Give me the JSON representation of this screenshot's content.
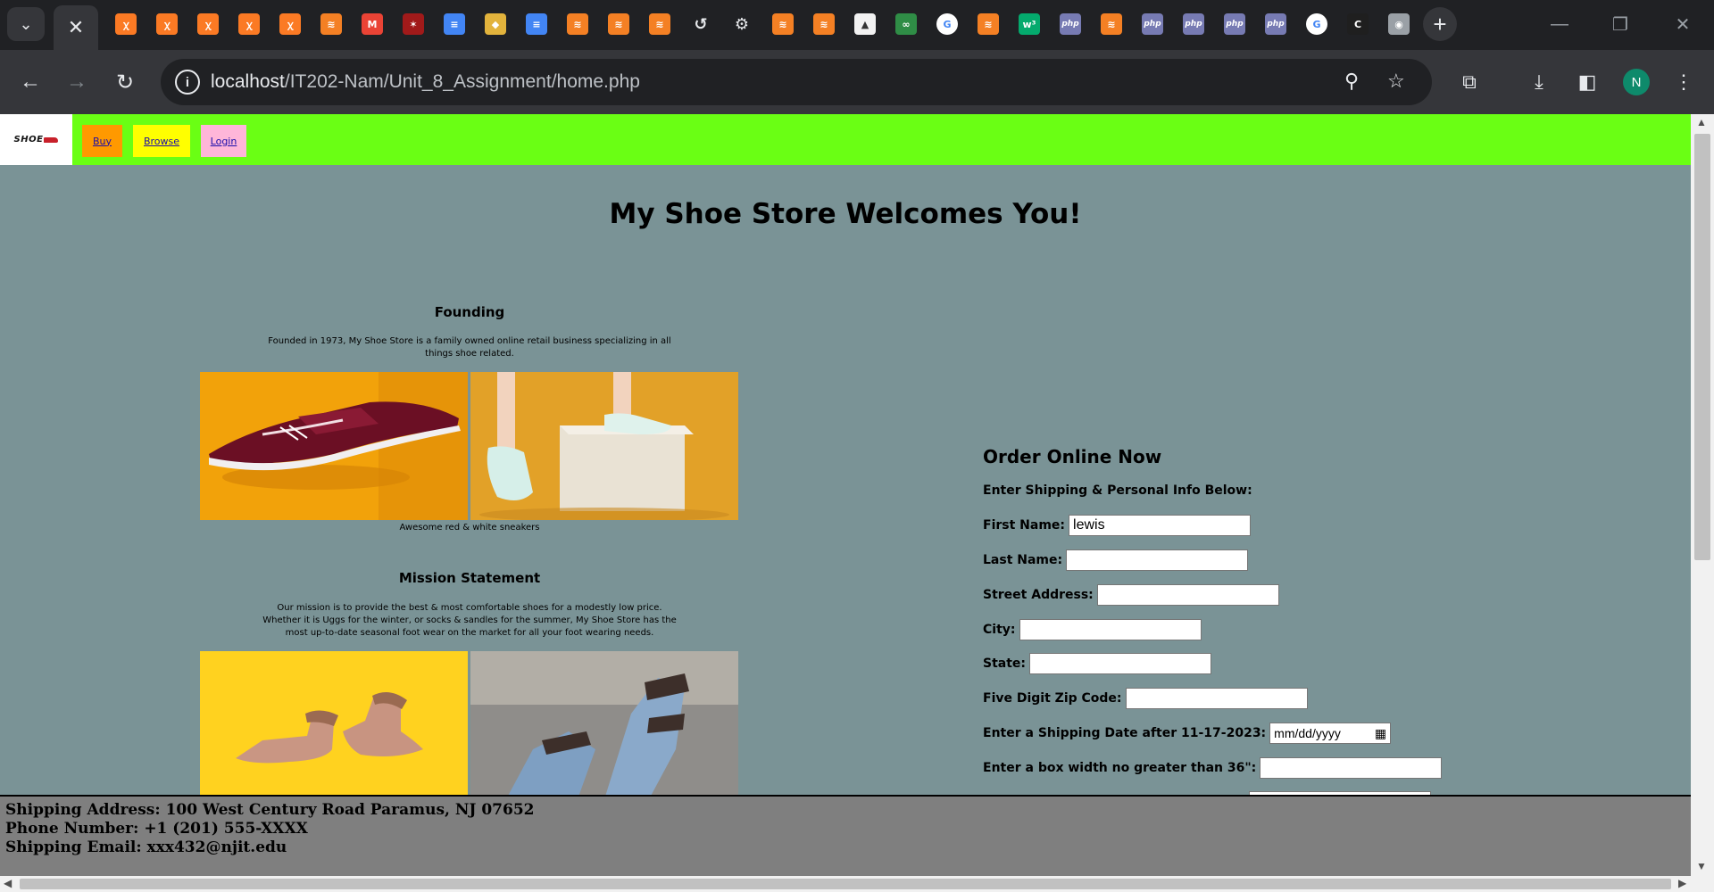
{
  "browser": {
    "active_tab_close": "✕",
    "url_host": "localhost",
    "url_path": "/IT202-Nam/Unit_8_Assignment/home.php",
    "profile_initial": "N",
    "tab_icons": [
      {
        "name": "xampp-icon",
        "glyph": "ꭓ",
        "color": "#fb7a24"
      },
      {
        "name": "xampp-icon",
        "glyph": "ꭓ",
        "color": "#fb7a24"
      },
      {
        "name": "xampp-icon",
        "glyph": "ꭓ",
        "color": "#fb7a24"
      },
      {
        "name": "xampp-icon",
        "glyph": "ꭓ",
        "color": "#fb7a24"
      },
      {
        "name": "xampp-icon",
        "glyph": "ꭓ",
        "color": "#fb7a24"
      },
      {
        "name": "stackoverflow-icon",
        "glyph": "≋",
        "color": "#f48024"
      },
      {
        "name": "gmail-icon",
        "glyph": "M",
        "color": "#ea4335"
      },
      {
        "name": "red-logo-icon",
        "glyph": "✶",
        "color": "#a11a1a"
      },
      {
        "name": "google-docs-icon",
        "glyph": "≡",
        "color": "#4285f4"
      },
      {
        "name": "shield-icon",
        "glyph": "◆",
        "color": "#e2b33c"
      },
      {
        "name": "google-docs-icon",
        "glyph": "≡",
        "color": "#4285f4"
      },
      {
        "name": "stackoverflow-icon",
        "glyph": "≋",
        "color": "#f48024"
      },
      {
        "name": "stackoverflow-icon",
        "glyph": "≋",
        "color": "#f48024"
      },
      {
        "name": "stackoverflow-icon",
        "glyph": "≋",
        "color": "#f48024"
      },
      {
        "name": "history-icon",
        "glyph": "↺",
        "color": "#5f6368"
      },
      {
        "name": "settings-icon",
        "glyph": "⚙",
        "color": "#5f6368"
      },
      {
        "name": "stackoverflow-icon",
        "glyph": "≋",
        "color": "#f48024"
      },
      {
        "name": "stackoverflow-icon",
        "glyph": "≋",
        "color": "#f48024"
      },
      {
        "name": "phpmyadmin-icon",
        "glyph": "▲",
        "color": "#f2f2f2"
      },
      {
        "name": "geeksforgeeks-icon",
        "glyph": "∞",
        "color": "#2f8d46"
      },
      {
        "name": "google-icon",
        "glyph": "G",
        "color": "#ffffff"
      },
      {
        "name": "stackoverflow-icon",
        "glyph": "≋",
        "color": "#f48024"
      },
      {
        "name": "w3schools-icon",
        "glyph": "w³",
        "color": "#04aa6d"
      },
      {
        "name": "php-icon",
        "glyph": "php",
        "color": "#777bb3"
      },
      {
        "name": "stackoverflow-icon",
        "glyph": "≋",
        "color": "#f48024"
      },
      {
        "name": "php-icon",
        "glyph": "php",
        "color": "#777bb3"
      },
      {
        "name": "php-icon",
        "glyph": "php",
        "color": "#777bb3"
      },
      {
        "name": "php-icon",
        "glyph": "php",
        "color": "#777bb3"
      },
      {
        "name": "php-icon",
        "glyph": "php",
        "color": "#777bb3"
      },
      {
        "name": "google-icon",
        "glyph": "G",
        "color": "#ffffff"
      },
      {
        "name": "c-logo-icon",
        "glyph": "C",
        "color": "#1f1f1f"
      },
      {
        "name": "chrome-icon",
        "glyph": "◉",
        "color": "#9aa0a6"
      }
    ]
  },
  "site": {
    "logo_text": "SHOE",
    "nav": [
      {
        "label": "Buy",
        "color": "#ff9900"
      },
      {
        "label": "Browse",
        "color": "#ffff00"
      },
      {
        "label": "Login",
        "color": "#ffb6d9"
      }
    ],
    "title": "My Shoe Store Welcomes You!",
    "founding": {
      "heading": "Founding",
      "text": "Founded in 1973, My Shoe Store is a family owned online retail business specializing in all things shoe related.",
      "caption": "Awesome red & white sneakers"
    },
    "mission": {
      "heading": "Mission Statement",
      "text": "Our mission is to provide the best & most comfortable shoes for a modestly low price. Whether it is Uggs for the winter, or socks & sandles for the summer, My Shoe Store has the most up-to-date seasonal foot wear on the market for all your foot wearing needs."
    },
    "form": {
      "title": "Order Online Now",
      "subtitle": "Enter Shipping & Personal Info Below:",
      "first_name_label": "First Name:",
      "first_name_value": "lewis",
      "last_name_label": "Last Name:",
      "street_label": "Street Address:",
      "city_label": "City:",
      "state_label": "State:",
      "zip_label": "Five Digit Zip Code:",
      "date_label": "Enter a Shipping Date after 11-17-2023:",
      "date_placeholder": "mm/dd/yyyy",
      "box_width_label": "Enter a box width no greater than 36\":"
    },
    "footer": {
      "address": "Shipping Address: 100 West Century Road Paramus, NJ 07652",
      "phone": "Phone Number: +1 (201) 555-XXXX",
      "email": "Shipping Email: xxx432@njit.edu"
    }
  }
}
